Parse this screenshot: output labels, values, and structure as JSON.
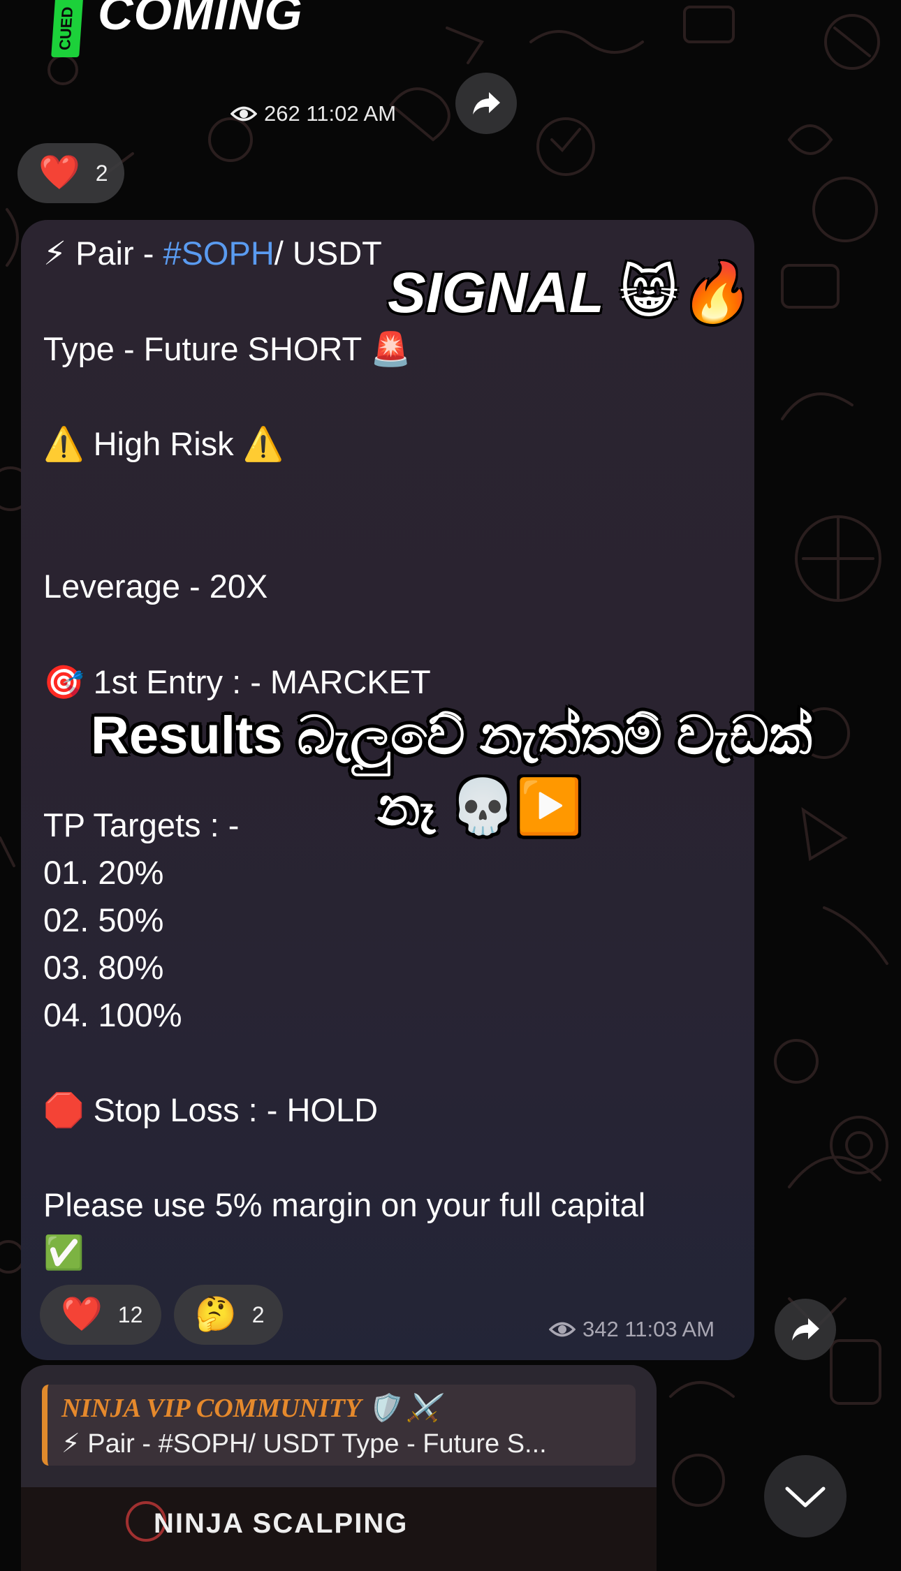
{
  "top_sticker": {
    "tag_text": "CUED",
    "title": "COMING"
  },
  "prev_message": {
    "views": "262",
    "time": "11:02 AM",
    "reaction_emoji": "❤️",
    "reaction_count": "2"
  },
  "message": {
    "lines": [
      {
        "icon": "⚡",
        "prefix": " Pair - ",
        "hashtag": "#SOPH",
        "suffix": "/ USDT"
      },
      "Type - Future  SHORT  🚨",
      "⚠️ High Risk ⚠️",
      "Leverage - 20X",
      "🎯 1st Entry : -  MARCKET",
      "TP Targets : -",
      "01. 20%",
      "02. 50%",
      "03. 80%",
      "04. 100%",
      "🛑 Stop Loss : - HOLD",
      "Please use 5% margin on your full capital",
      "✅"
    ],
    "reactions": [
      {
        "emoji": "❤️",
        "count": "12"
      },
      {
        "emoji": "🤔",
        "count": "2"
      }
    ],
    "views": "342",
    "time": "11:03 AM"
  },
  "overlays": {
    "signal": "SIGNAL 😸🔥",
    "results_line1": "Results බැලුවේ නැත්තම් වැඩක්",
    "results_line2": "නෑ 💀▶️"
  },
  "reply": {
    "title": "NINJA VIP COMMUNITY 🛡️ ⚔️",
    "preview": "⚡ Pair - #SOPH/ USDT Type - Future S...",
    "image_text": "NINJA SCALPING"
  },
  "icons": {
    "eye": "eye-icon",
    "forward": "forward-icon",
    "scroll_down": "chevron-down-icon"
  },
  "colors": {
    "hashtag": "#5a9bf0",
    "reply_accent": "#e08a2c",
    "bubble": "#2a2330"
  }
}
